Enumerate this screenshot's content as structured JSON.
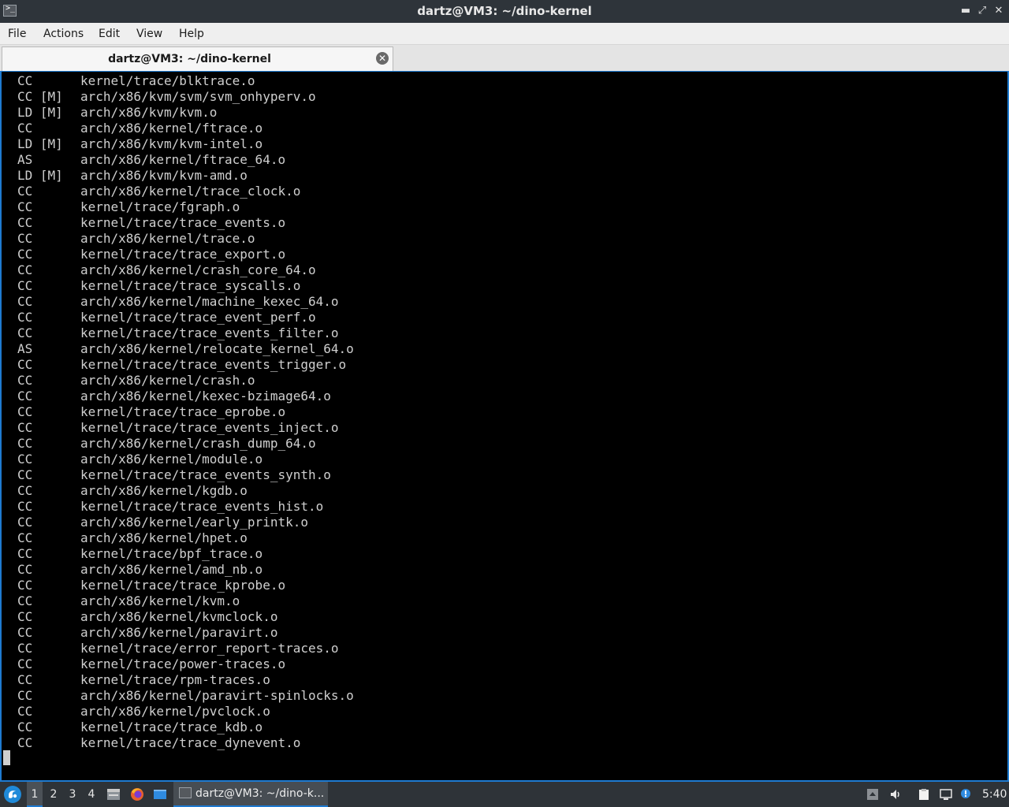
{
  "window": {
    "title": "dartz@VM3: ~/dino-kernel",
    "minimize_glyph": "▬",
    "maximize_glyph": "⤢",
    "close_glyph": "✕"
  },
  "menu": [
    "File",
    "Actions",
    "Edit",
    "View",
    "Help"
  ],
  "tab": {
    "label": "dartz@VM3: ~/dino-kernel",
    "close_glyph": "✕"
  },
  "terminal": {
    "lines": [
      {
        "tag": "CC",
        "path": "kernel/trace/blktrace.o"
      },
      {
        "tag": "CC [M]",
        "path": "arch/x86/kvm/svm/svm_onhyperv.o"
      },
      {
        "tag": "LD [M]",
        "path": "arch/x86/kvm/kvm.o"
      },
      {
        "tag": "CC",
        "path": "arch/x86/kernel/ftrace.o"
      },
      {
        "tag": "LD [M]",
        "path": "arch/x86/kvm/kvm-intel.o"
      },
      {
        "tag": "AS",
        "path": "arch/x86/kernel/ftrace_64.o"
      },
      {
        "tag": "LD [M]",
        "path": "arch/x86/kvm/kvm-amd.o"
      },
      {
        "tag": "CC",
        "path": "arch/x86/kernel/trace_clock.o"
      },
      {
        "tag": "CC",
        "path": "kernel/trace/fgraph.o"
      },
      {
        "tag": "CC",
        "path": "kernel/trace/trace_events.o"
      },
      {
        "tag": "CC",
        "path": "arch/x86/kernel/trace.o"
      },
      {
        "tag": "CC",
        "path": "kernel/trace/trace_export.o"
      },
      {
        "tag": "CC",
        "path": "arch/x86/kernel/crash_core_64.o"
      },
      {
        "tag": "CC",
        "path": "kernel/trace/trace_syscalls.o"
      },
      {
        "tag": "CC",
        "path": "arch/x86/kernel/machine_kexec_64.o"
      },
      {
        "tag": "CC",
        "path": "kernel/trace/trace_event_perf.o"
      },
      {
        "tag": "CC",
        "path": "kernel/trace/trace_events_filter.o"
      },
      {
        "tag": "AS",
        "path": "arch/x86/kernel/relocate_kernel_64.o"
      },
      {
        "tag": "CC",
        "path": "kernel/trace/trace_events_trigger.o"
      },
      {
        "tag": "CC",
        "path": "arch/x86/kernel/crash.o"
      },
      {
        "tag": "CC",
        "path": "arch/x86/kernel/kexec-bzimage64.o"
      },
      {
        "tag": "CC",
        "path": "kernel/trace/trace_eprobe.o"
      },
      {
        "tag": "CC",
        "path": "kernel/trace/trace_events_inject.o"
      },
      {
        "tag": "CC",
        "path": "arch/x86/kernel/crash_dump_64.o"
      },
      {
        "tag": "CC",
        "path": "arch/x86/kernel/module.o"
      },
      {
        "tag": "CC",
        "path": "kernel/trace/trace_events_synth.o"
      },
      {
        "tag": "CC",
        "path": "arch/x86/kernel/kgdb.o"
      },
      {
        "tag": "CC",
        "path": "kernel/trace/trace_events_hist.o"
      },
      {
        "tag": "CC",
        "path": "arch/x86/kernel/early_printk.o"
      },
      {
        "tag": "CC",
        "path": "arch/x86/kernel/hpet.o"
      },
      {
        "tag": "CC",
        "path": "kernel/trace/bpf_trace.o"
      },
      {
        "tag": "CC",
        "path": "arch/x86/kernel/amd_nb.o"
      },
      {
        "tag": "CC",
        "path": "kernel/trace/trace_kprobe.o"
      },
      {
        "tag": "CC",
        "path": "arch/x86/kernel/kvm.o"
      },
      {
        "tag": "CC",
        "path": "arch/x86/kernel/kvmclock.o"
      },
      {
        "tag": "CC",
        "path": "arch/x86/kernel/paravirt.o"
      },
      {
        "tag": "CC",
        "path": "kernel/trace/error_report-traces.o"
      },
      {
        "tag": "CC",
        "path": "kernel/trace/power-traces.o"
      },
      {
        "tag": "CC",
        "path": "kernel/trace/rpm-traces.o"
      },
      {
        "tag": "CC",
        "path": "arch/x86/kernel/paravirt-spinlocks.o"
      },
      {
        "tag": "CC",
        "path": "arch/x86/kernel/pvclock.o"
      },
      {
        "tag": "CC",
        "path": "kernel/trace/trace_kdb.o"
      },
      {
        "tag": "CC",
        "path": "kernel/trace/trace_dynevent.o"
      }
    ]
  },
  "taskbar": {
    "workspaces": [
      "1",
      "2",
      "3",
      "4"
    ],
    "active_workspace": "1",
    "task_label": "dartz@VM3: ~/dino-k...",
    "clock": "5:40",
    "tray_icons": [
      "tray-up-icon",
      "volume-icon",
      "clipboard-icon",
      "network-icon",
      "notification-icon"
    ]
  },
  "colors": {
    "accent": "#1e7ad0",
    "terminal_bg": "#000000",
    "terminal_fg": "#cfcfcf",
    "titlebar_bg": "#2e343a",
    "taskbar_bg": "#2e3338"
  }
}
